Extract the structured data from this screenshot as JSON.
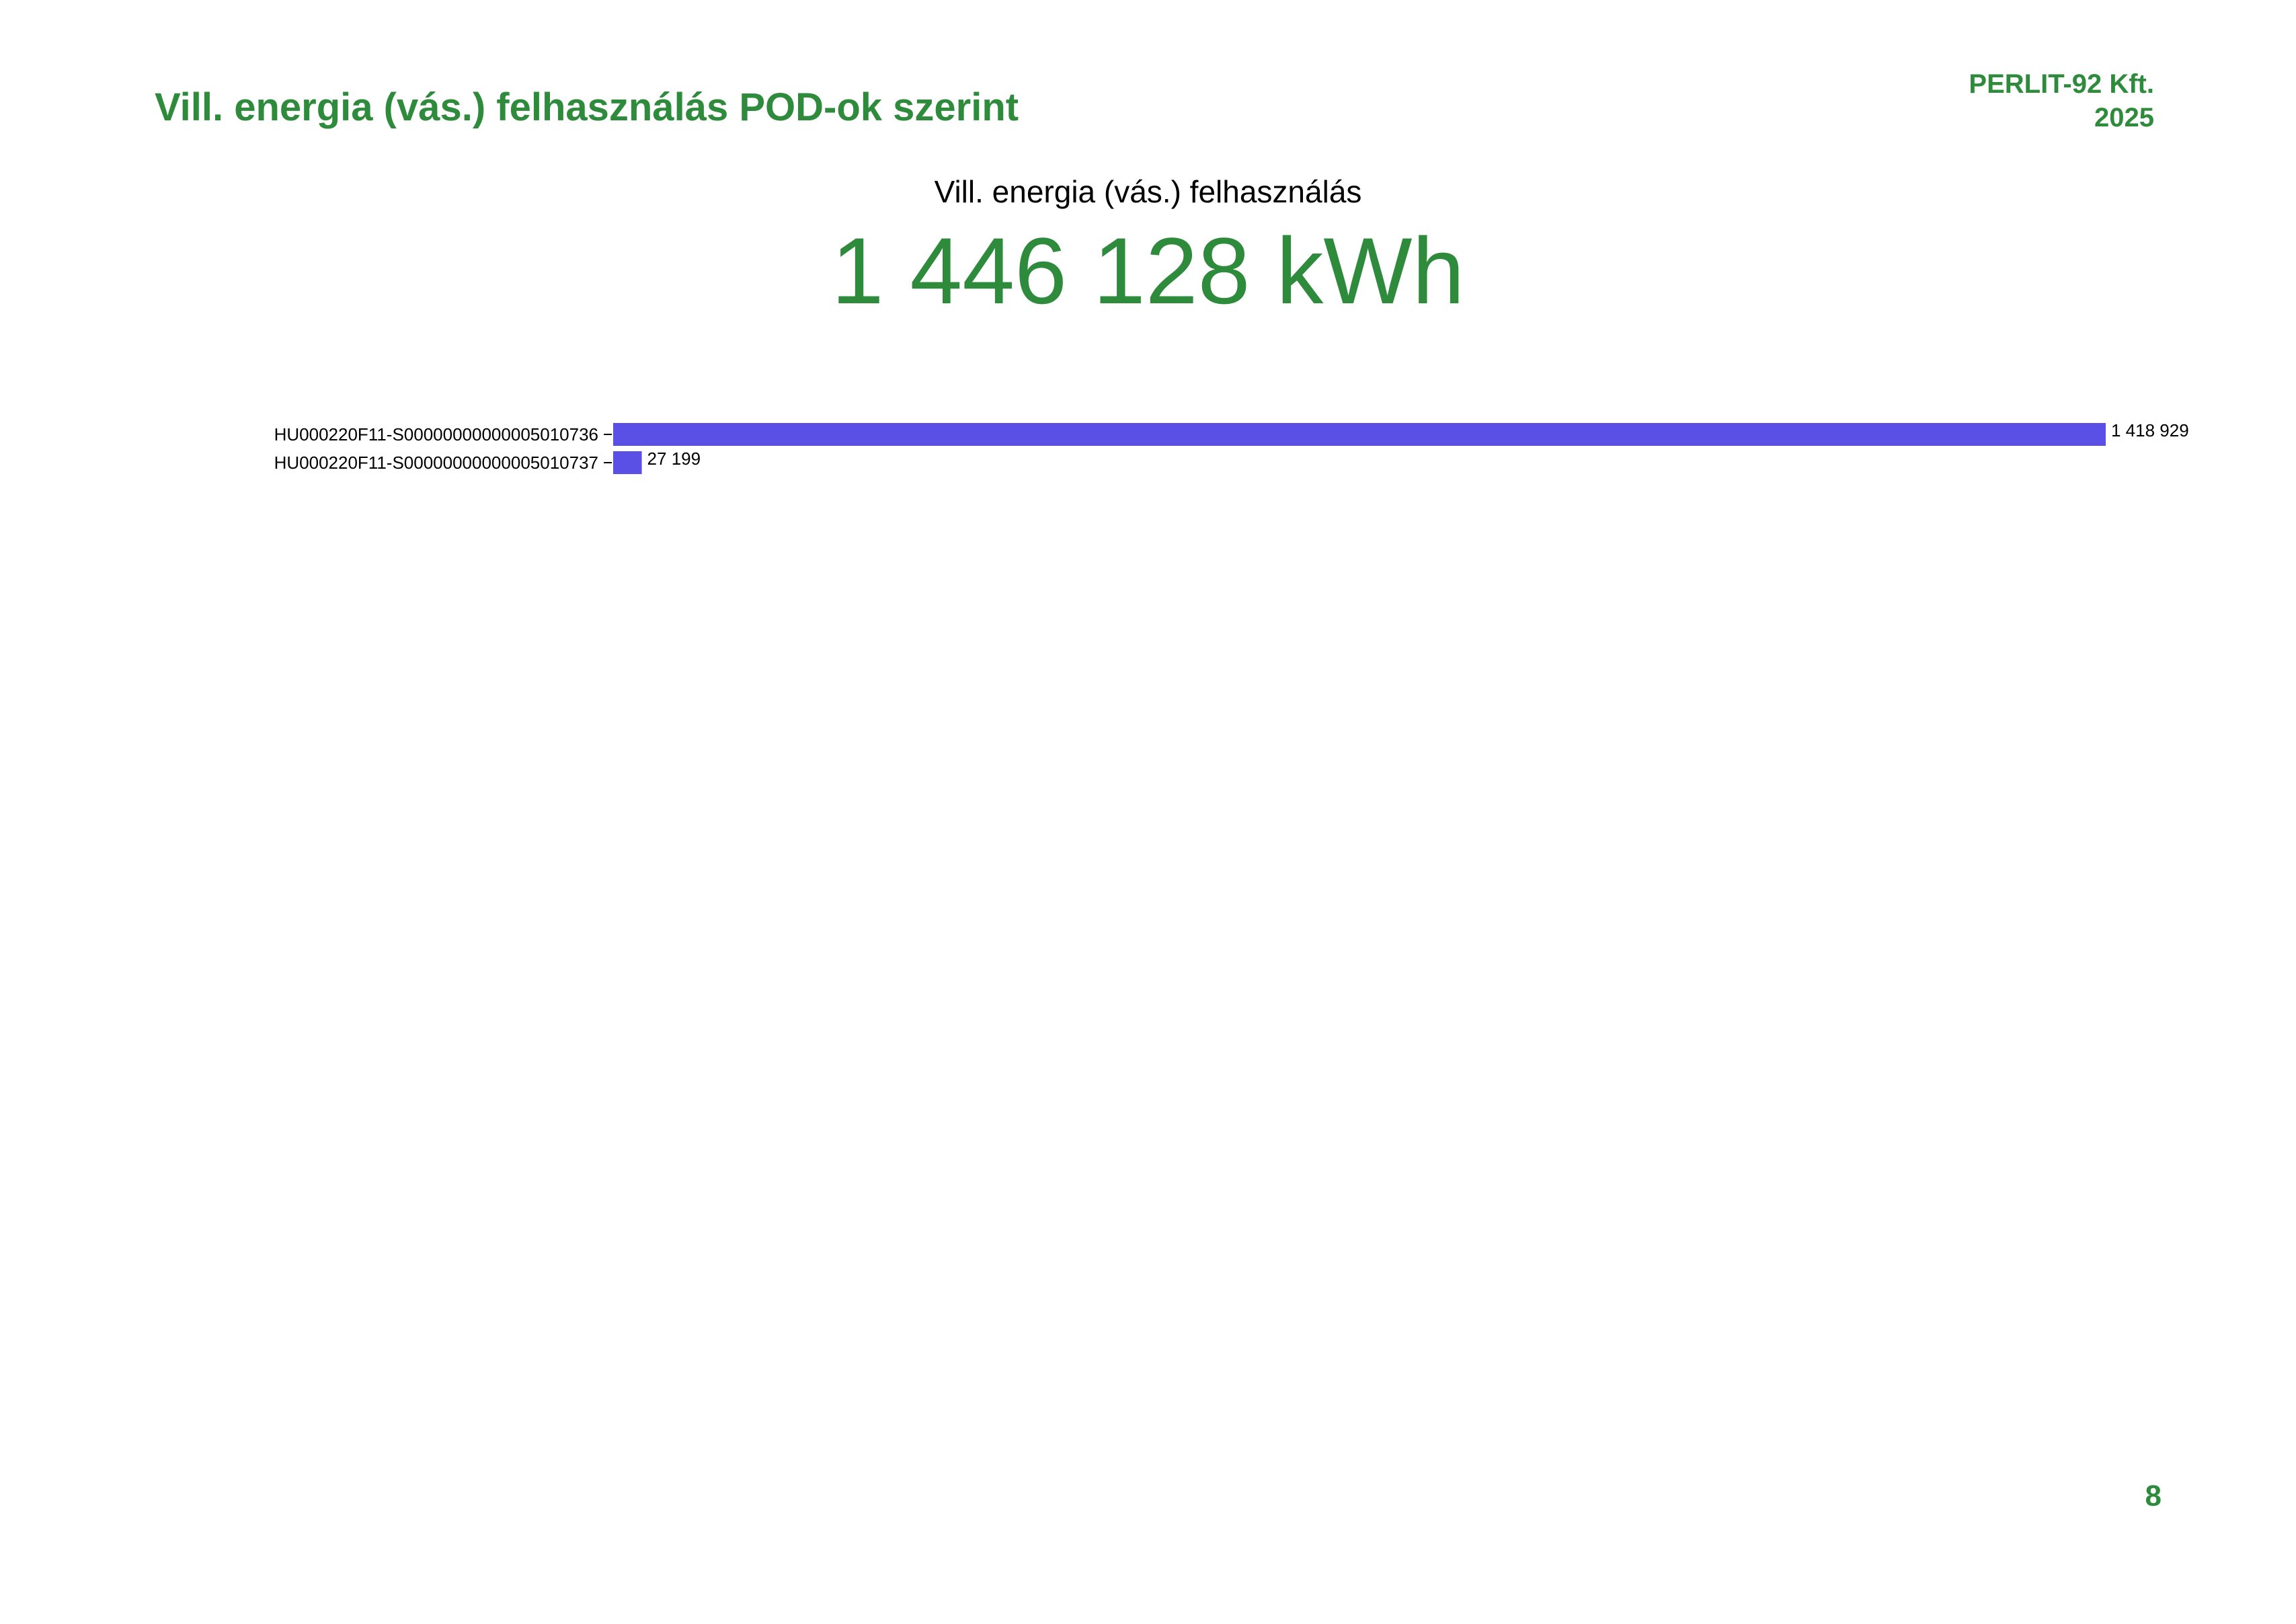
{
  "header": {
    "title": "Vill. energia (vás.) felhasználás POD-ok szerint",
    "company": "PERLIT-92 Kft.",
    "year": "2025"
  },
  "kpi": {
    "label": "Vill. energia (vás.) felhasználás",
    "value": "1 446 128 kWh"
  },
  "chart_data": {
    "type": "bar",
    "orientation": "horizontal",
    "categories": [
      "HU000220F11-S00000000000005010736",
      "HU000220F11-S00000000000005010737"
    ],
    "values": [
      1418929,
      27199
    ],
    "value_labels": [
      "1 418 929",
      "27 199"
    ],
    "bar_color": "#5b50e6",
    "grid": false,
    "legend": "none"
  },
  "footer": {
    "page_number": "8"
  }
}
